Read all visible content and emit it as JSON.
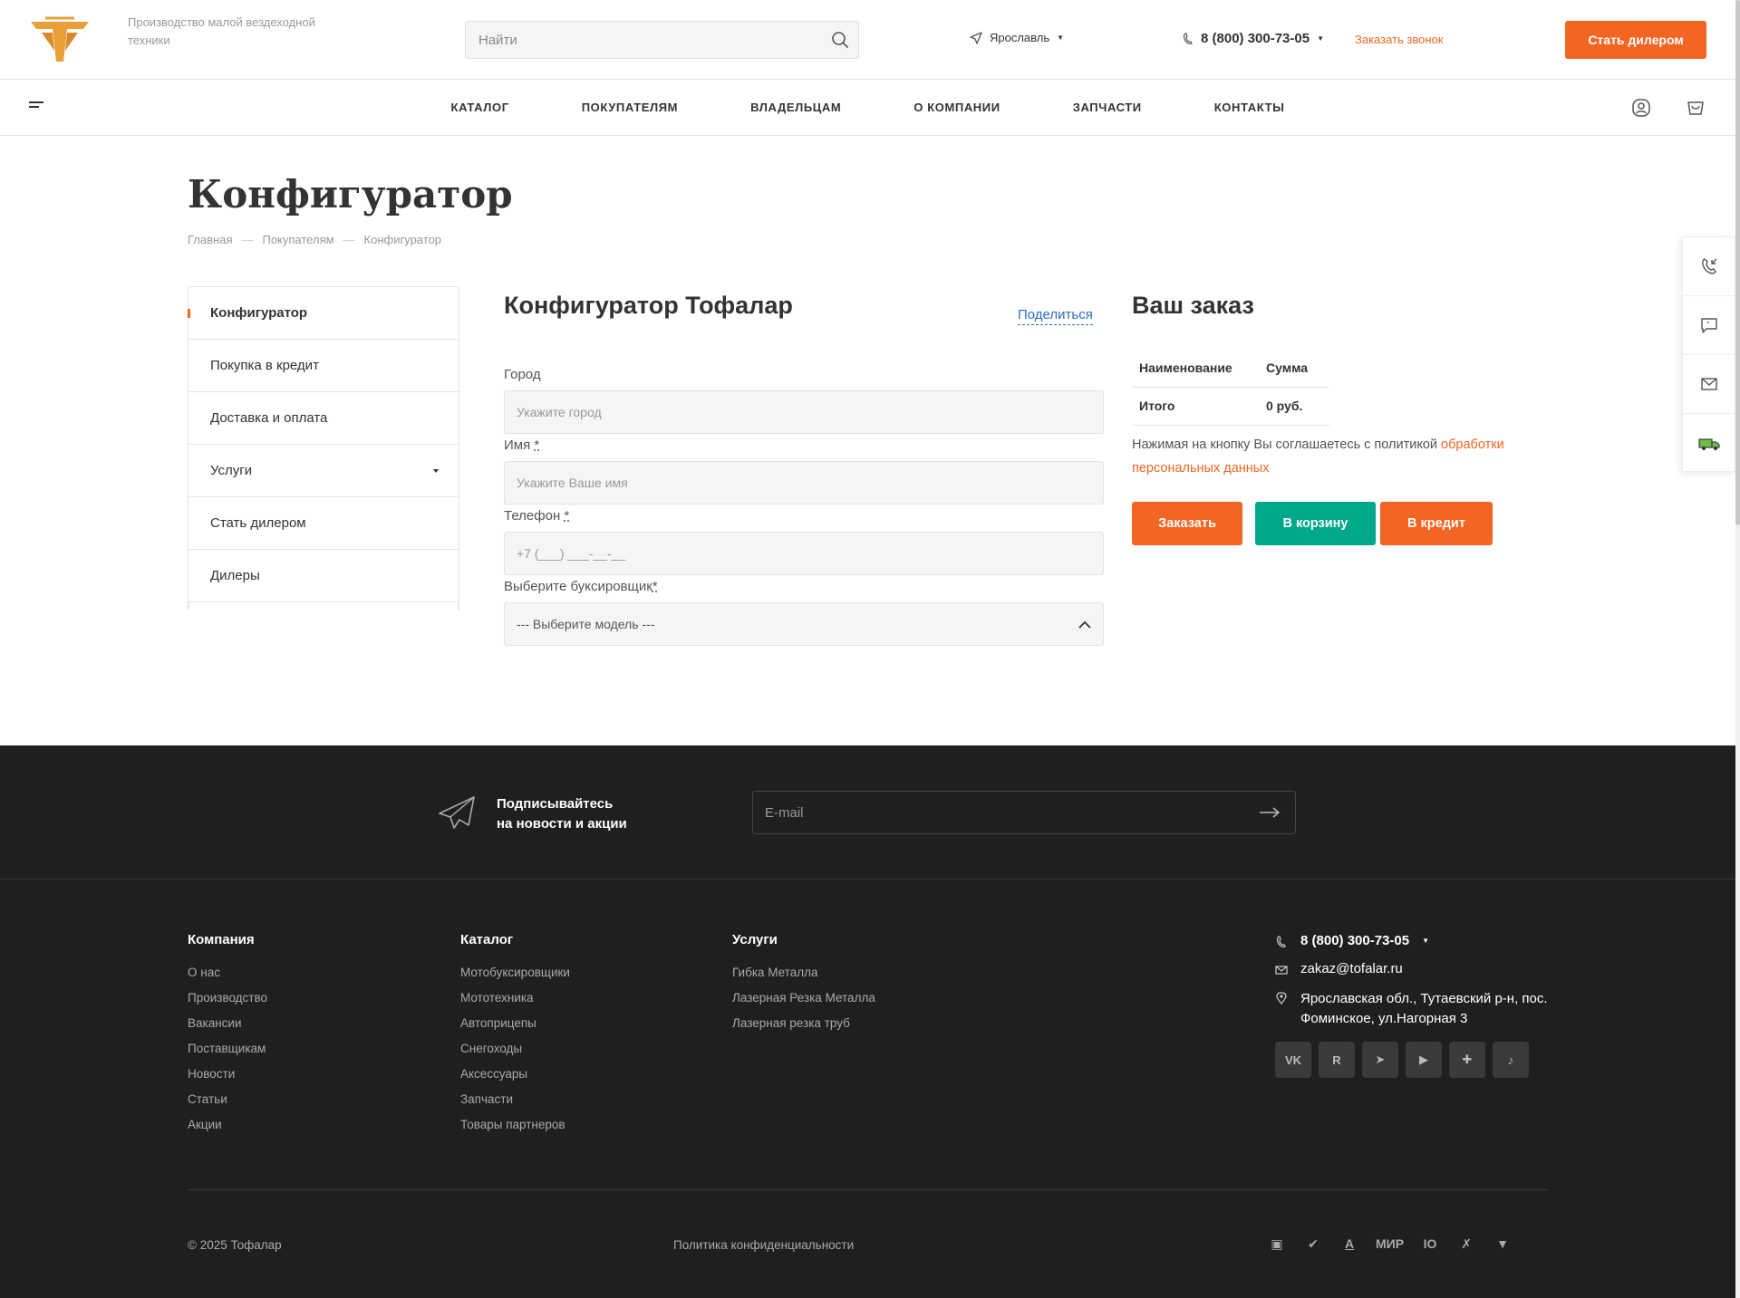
{
  "header": {
    "slogan": "Производство малой вездеходной техники",
    "search_placeholder": "Найти",
    "city": "Ярославль",
    "phone": "8 (800) 300-73-05",
    "callback": "Заказать звонок",
    "dealer_button": "Стать дилером"
  },
  "nav": {
    "items": [
      "КАТАЛОГ",
      "ПОКУПАТЕЛЯМ",
      "ВЛАДЕЛЬЦАМ",
      "О КОМПАНИИ",
      "ЗАПЧАСТИ",
      "КОНТАКТЫ"
    ]
  },
  "page": {
    "title": "Конфигуратор",
    "breadcrumb": [
      "Главная",
      "Покупателям",
      "Конфигуратор"
    ]
  },
  "sidebar": {
    "items": [
      "Конфигуратор",
      "Покупка в кредит",
      "Доставка и оплата",
      "Услуги",
      "Стать дилером",
      "Дилеры"
    ]
  },
  "configurator": {
    "title": "Конфигуратор Тофалар",
    "share": "Поделиться",
    "city_label": "Город",
    "city_placeholder": "Укажите город",
    "name_label": "Имя",
    "name_placeholder": "Укажите Ваше имя",
    "phone_label": "Телефон",
    "phone_placeholder": "+7 (___) ___-__-__",
    "model_label": "Выберите буксировщик",
    "model_value": "--- Выберите модель ---",
    "required_mark": "*"
  },
  "order": {
    "title": "Ваш заказ",
    "col_name": "Наименование",
    "col_sum": "Сумма",
    "total_label": "Итого",
    "total_value": "0 руб.",
    "consent_text": "Нажимая на кнопку Вы соглашаетесь с политикой ",
    "consent_link": "обработки персональных данных",
    "btn_order": "Заказать",
    "btn_cart": "В корзину",
    "btn_credit": "В кредит"
  },
  "subscribe": {
    "title_line1": "Подписывайтесь",
    "title_line2": "на новости и акции",
    "email_placeholder": "E-mail"
  },
  "footer": {
    "company_title": "Компания",
    "company_items": [
      "О нас",
      "Производство",
      "Вакансии",
      "Поставщикам",
      "Новости",
      "Статьи",
      "Акции"
    ],
    "catalog_title": "Каталог",
    "catalog_items": [
      "Мотобуксировщики",
      "Мототехника",
      "Автоприцепы",
      "Снегоходы",
      "Аксессуары",
      "Запчасти",
      "Товары партнеров"
    ],
    "services_title": "Услуги",
    "services_items": [
      "Гибка Металла",
      "Лазерная Резка Металла",
      "Лазерная резка труб"
    ],
    "phone": "8 (800) 300-73-05",
    "email": "zakaz@tofalar.ru",
    "address": "Ярославская обл., Тутаевский р-н, пос. Фоминское, ул.Нагорная 3",
    "socials": [
      "vk-icon",
      "rutube-icon",
      "telegram-icon",
      "youtube-icon",
      "dzen-icon",
      "tiktok-icon"
    ],
    "social_glyphs": [
      "VK",
      "R",
      "➤",
      "▶",
      "✚",
      "♪"
    ],
    "copyright": "© 2025 Тофалар",
    "policy": "Политика конфиденциальности",
    "payments": [
      "card-icon",
      "sbp-icon",
      "alfa-icon",
      "mir-icon",
      "yumoney-icon",
      "x-icon",
      "shield-icon"
    ],
    "payment_glyphs": [
      "▣",
      "✔",
      "A",
      "МИР",
      "IO",
      "✗",
      "▼"
    ]
  },
  "colors": {
    "accent": "#f26522",
    "green": "#00a88a",
    "link_blue": "#2a6dbd",
    "footer_bg": "#1f1f1f"
  }
}
